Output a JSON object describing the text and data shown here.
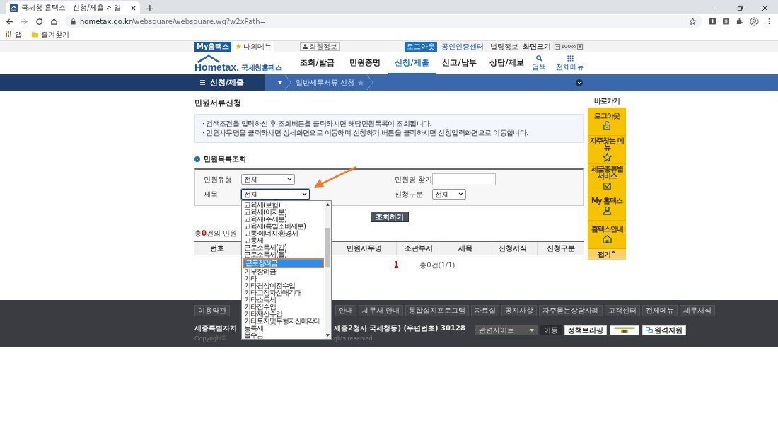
{
  "browser": {
    "tab_title": "국세청 홈택스 - 신청/제출 > 일",
    "new_tab": "+",
    "url_host": "hometax.go.kr",
    "url_path": "/websquare/websquare.wq?w2xPath=",
    "bookmarks": [
      "앱",
      "즐겨찾기"
    ]
  },
  "util_bar": {
    "my_hometax": "My홈택스",
    "my_menu": "나의메뉴",
    "member_info": "회원정보",
    "logout": "로그아웃",
    "links": [
      "공인인증센터",
      "법령정보"
    ],
    "zoom_label": "화면크기",
    "zoom_value": "100%"
  },
  "logo": {
    "wordmark": "Hometax.",
    "name": "국세청홈택스"
  },
  "nav": [
    {
      "label": "조회/발급",
      "selected": false
    },
    {
      "label": "민원증명",
      "selected": false
    },
    {
      "label": "신청/제출",
      "selected": true
    },
    {
      "label": "신고/납부",
      "selected": false
    },
    {
      "label": "상담/제보",
      "selected": false
    }
  ],
  "nav_tools": [
    "검색",
    "전체메뉴"
  ],
  "menu_bar": {
    "section": "신청/제출",
    "breadcrumb": "일반세무서류 신청"
  },
  "page_title": "민원서류신청",
  "notices": [
    "· 검색조건을 입력하신 후 조회버튼을 클릭하시면 해당민원목록이 조회됩니다.",
    "· 민원사무명을 클릭하시면 상세화면으로 이동하며   신청하기 버튼을 클릭하시면 신청입력화면으로 이동합니다."
  ],
  "search": {
    "title": "민원목록조회",
    "fields": [
      {
        "kind": "select",
        "label": "민원유형",
        "value": "전체",
        "expanded": false
      },
      {
        "kind": "text",
        "label": "민원명 찾기"
      },
      {
        "kind": "select",
        "label": "세목",
        "value": "전체",
        "expanded": true
      },
      {
        "kind": "select",
        "label": "신청구분",
        "value": "전체",
        "expanded": false
      }
    ],
    "button": "조회하기"
  },
  "dropdown_options": [
    {
      "label": "교육세(보험)",
      "selected": false
    },
    {
      "label": "교육세(이자분)",
      "selected": false
    },
    {
      "label": "교육세(주세분)",
      "selected": false
    },
    {
      "label": "교육세(특별소비세분)",
      "selected": false
    },
    {
      "label": "교통·에너지·환경세",
      "selected": false
    },
    {
      "label": "교통세",
      "selected": false
    },
    {
      "label": "근로소득세(갑)",
      "selected": false
    },
    {
      "label": "근로소득세(을)",
      "selected": false
    },
    {
      "label": "근로장려금",
      "selected": true
    },
    {
      "label": "기부장려금",
      "selected": false
    },
    {
      "label": "기타",
      "selected": false
    },
    {
      "label": "기타경상이전수입",
      "selected": false
    },
    {
      "label": "기타고정자산매각대",
      "selected": false
    },
    {
      "label": "기타소득세",
      "selected": false
    },
    {
      "label": "기타잡수입",
      "selected": false
    },
    {
      "label": "기타재산수입",
      "selected": false
    },
    {
      "label": "기타토지및무형자산매각대",
      "selected": false
    },
    {
      "label": "농특세",
      "selected": false
    },
    {
      "label": "물수금",
      "selected": false
    }
  ],
  "result_count": {
    "prefix": "총",
    "count": "0",
    "suffix": "건의 민원"
  },
  "table": {
    "columns": [
      "번호",
      "민원사무명",
      "소관부서",
      "세목",
      "신청서식",
      "신청구분"
    ]
  },
  "pagination": {
    "page": "1",
    "summary": "총0건(1/1)"
  },
  "quick_menu": {
    "title": "바로가기",
    "items": [
      "로그아웃",
      "자주찾는 메뉴",
      "세금종류별 서비스",
      "My 홈택스",
      "홈택스안내"
    ],
    "fold": "접기^"
  },
  "footer": {
    "links_left": [
      "이용약관"
    ],
    "links": [
      "안내",
      "세무서 안내",
      "통합설치프로그램",
      "자료실",
      "공지사항",
      "자주묻는상담사례",
      "고객센터",
      "전체메뉴",
      "세무서식"
    ],
    "address_start": "세종특별자치",
    "address_end": "세종2청사 국세청동) (우편번호) 30128",
    "copyright_start": "Copyright©",
    "copyright_end": "ghts reserved.",
    "related_sites": "관련사이트",
    "go_button": "이동",
    "banners": [
      "정책브리핑",
      "원격지원"
    ]
  }
}
